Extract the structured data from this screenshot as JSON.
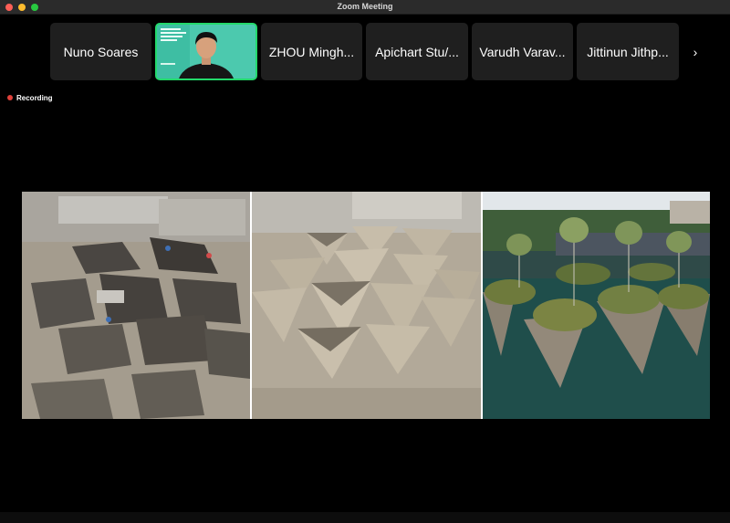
{
  "window": {
    "title": "Zoom Meeting"
  },
  "participants": [
    {
      "name": "Nuno Soares"
    },
    {
      "name": "ZHOU Mingh..."
    },
    {
      "name": "Apichart Stu/..."
    },
    {
      "name": "Varudh Varav..."
    },
    {
      "name": "Jittinun Jithp..."
    }
  ],
  "recording": {
    "label": "Recording",
    "color": "#e0413b"
  },
  "active_speaker_border": "#23d96b",
  "next_icon": "chevron-right-icon"
}
